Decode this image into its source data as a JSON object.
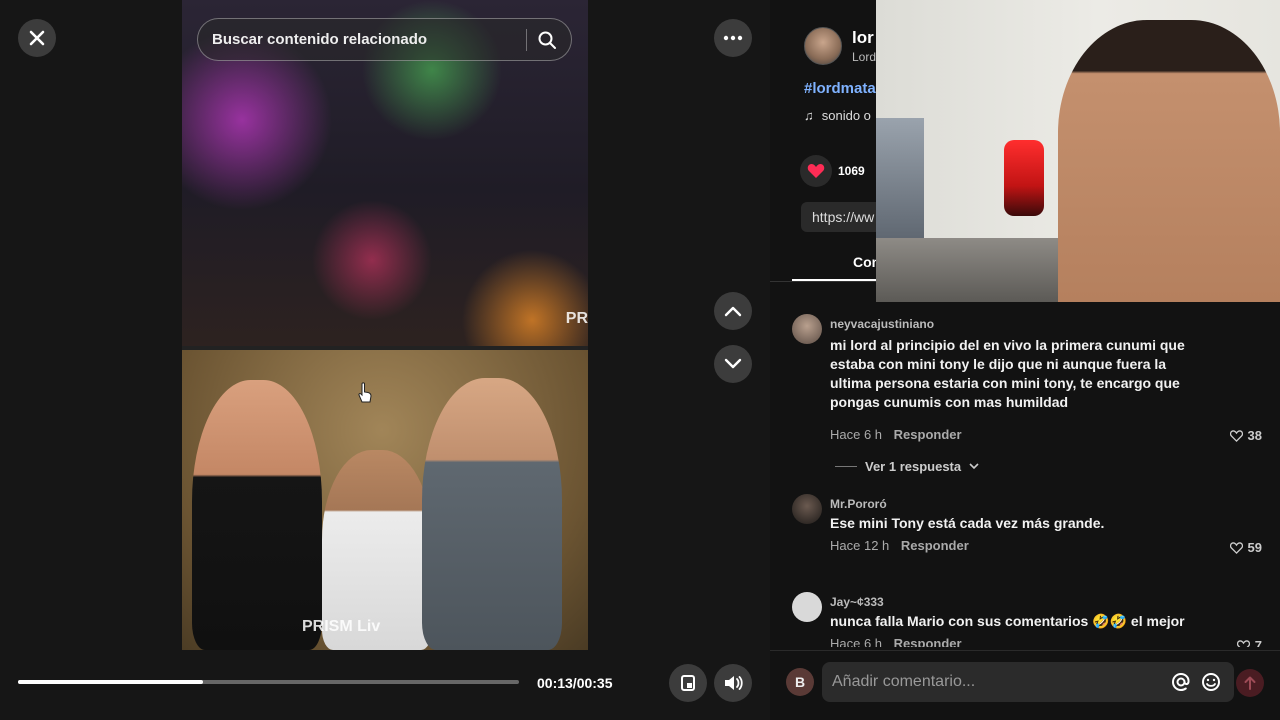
{
  "player": {
    "search_placeholder": "Buscar contenido relacionado",
    "time_display": "00:13/00:35",
    "progress_fraction": 0.37,
    "watermark_top": "PR",
    "watermark_bottom": "PRISM Liv"
  },
  "post": {
    "author_name": "lor",
    "author_sub": "Lord",
    "hashtag": "#lordmata",
    "music_label": "sonido o",
    "like_count": "1069",
    "link_text": "https://ww",
    "comments_tab": "Com"
  },
  "comments": [
    {
      "user": "neyvacajustiniano",
      "text": "mi lord al principio del en vivo la primera cunumi que estaba con mini tony le dijo que ni aunque fuera la ultima persona estaria con mini tony, te encargo que pongas cunumis con mas humildad",
      "time": "Hace 6 h",
      "reply": "Responder",
      "likes": "38",
      "view_replies": "Ver 1 respuesta"
    },
    {
      "user": "Mr.Pororó",
      "text": "Ese mini Tony está cada vez más grande.",
      "time": "Hace 12 h",
      "reply": "Responder",
      "likes": "59"
    },
    {
      "user": "Jay~¢333",
      "text": "nunca falla Mario con sus comentarios 🤣🤣 el mejor",
      "time": "Hace 6 h",
      "reply": "Responder",
      "likes": "7"
    }
  ],
  "composer": {
    "avatar_letter": "B",
    "placeholder": "Añadir comentario..."
  },
  "colors": {
    "accent_red": "#fe2c55",
    "hashtag_blue": "#7fb2ff"
  }
}
